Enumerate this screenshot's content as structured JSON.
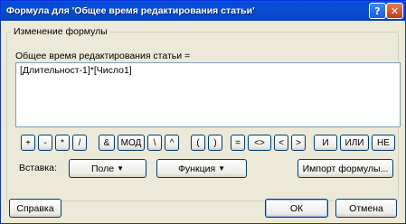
{
  "window": {
    "title": "Формула для 'Общее время редактирования статьи'",
    "help_glyph": "?",
    "close_glyph": "✕"
  },
  "group": {
    "legend": "Изменение формулы"
  },
  "formula": {
    "label": "Общее время редактирования статьи =",
    "value": "[Длительност-1]*[Число1]"
  },
  "operators": [
    "+",
    "-",
    "*",
    "/",
    "&",
    "МОД",
    "\\",
    "^",
    "(",
    ")",
    "=",
    "<>",
    "<",
    ">",
    "И",
    "ИЛИ",
    "НЕ"
  ],
  "insert": {
    "label": "Вставка:",
    "field_button": "Поле",
    "function_button": "Функция",
    "import_button": "Импорт формулы..."
  },
  "footer": {
    "help_button": "Справка",
    "ok_button": "ОК",
    "cancel_button": "Отмена"
  },
  "colors": {
    "titlebar": "#0549d6",
    "window_bg": "#ece9d8",
    "button_border": "#003c74"
  }
}
